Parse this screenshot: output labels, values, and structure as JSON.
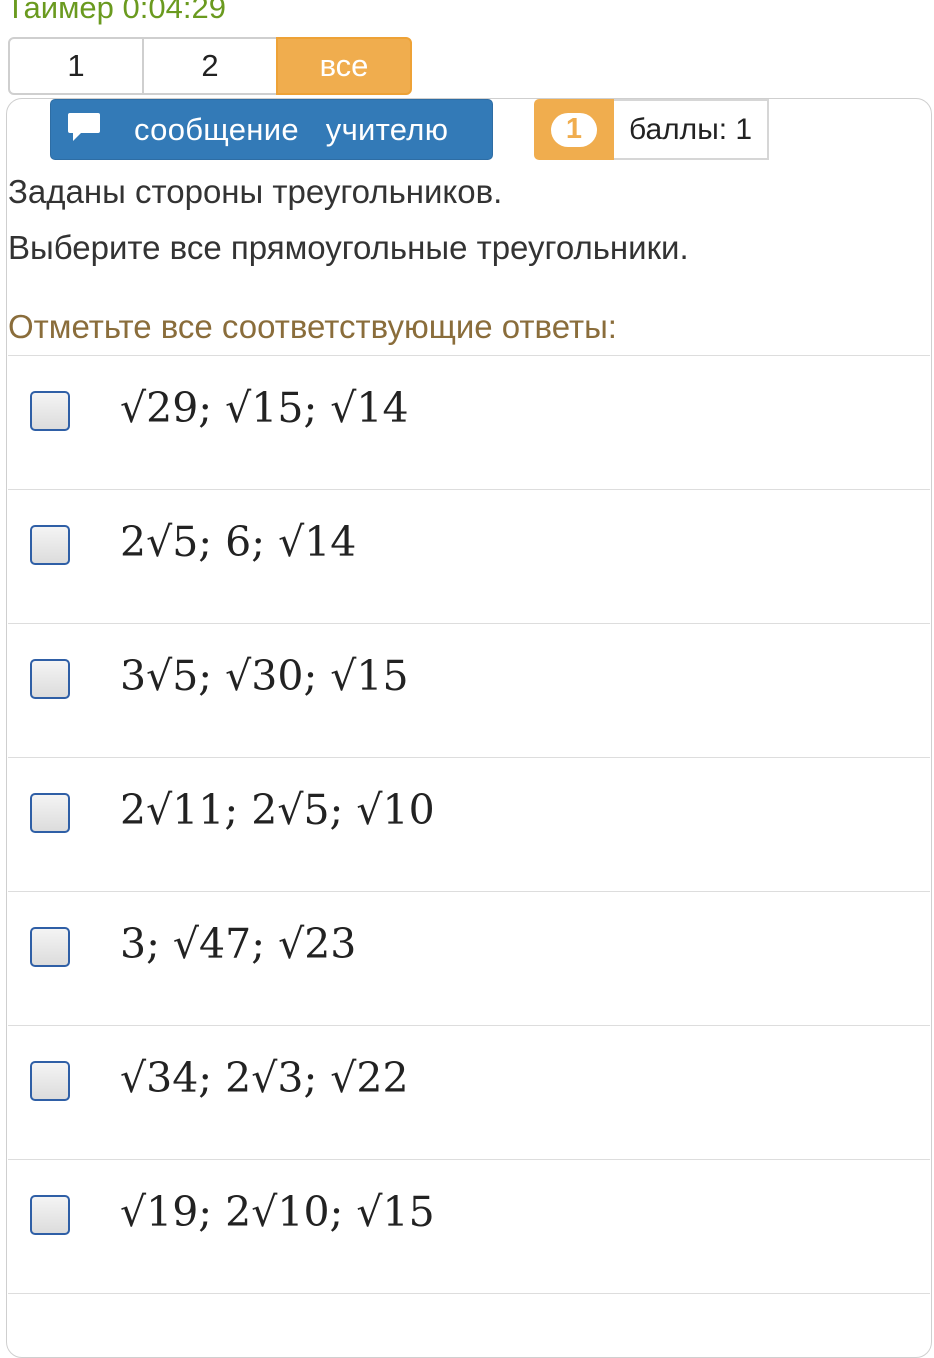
{
  "timer": "Таймер 0:04:29",
  "pagination": [
    "1",
    "2",
    "все"
  ],
  "active_page": "все",
  "message_button": "сообщение учителю",
  "score": {
    "number": "1",
    "text": "баллы: 1"
  },
  "question": {
    "line1": "Заданы стороны треугольников.",
    "line2": "Выберите все прямоугольные треугольники."
  },
  "instruction": "Отметьте все соответствующие ответы:",
  "options": [
    "√29; √15; √14",
    "2√5; 6; √14",
    "3√5; √30; √15",
    "2√11; 2√5; √10",
    "3; √47; √23",
    "√34; 2√3; √22",
    "√19; 2√10; √15"
  ],
  "colors": {
    "timer": "#6a9a1f",
    "accent": "#f0ad4e",
    "primary": "#337ab7",
    "instruction": "#8a6d3b"
  }
}
